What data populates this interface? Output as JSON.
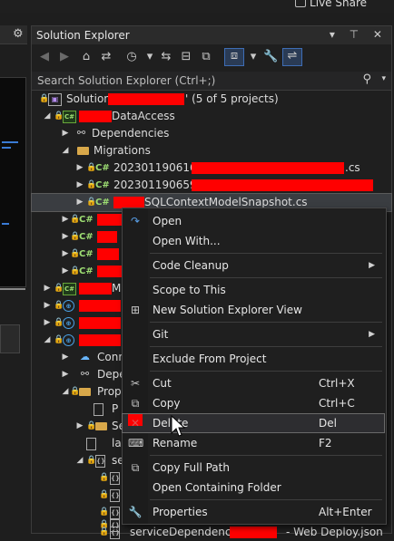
{
  "top": {
    "live_share": "Live Share"
  },
  "explorer": {
    "title": "Solution Explorer",
    "title_buttons": "▾ ⊤ ✕",
    "search_placeholder": "Search Solution Explorer (Ctrl+;)",
    "tree": [
      {
        "icon": "sol",
        "icon_text": "▣",
        "label": "Solution '",
        "suffix": "' (5 of 5 projects)"
      },
      {
        "icon": "proj",
        "icon_text": "C#",
        "label": "DataAccess"
      },
      {
        "icon": "dep",
        "icon_text": "⚯",
        "label": "Dependencies"
      },
      {
        "icon": "folder",
        "icon_text": "",
        "label": "Migrations"
      },
      {
        "icon": "cs",
        "icon_text": "C#",
        "label": "20230119061616_",
        "suffix": ".cs"
      },
      {
        "icon": "cs",
        "icon_text": "C#",
        "label": "20230119065917_"
      },
      {
        "icon": "cs",
        "icon_text": "C#",
        "label": "SQLContextModelSnapshot.cs"
      },
      {
        "icon": "cs",
        "icon_text": "C#",
        "label": ""
      },
      {
        "icon": "cs",
        "icon_text": "C#",
        "label": ""
      },
      {
        "icon": "cs",
        "icon_text": "C#",
        "label": ""
      },
      {
        "icon": "cs",
        "icon_text": "C#",
        "label": ""
      },
      {
        "icon": "proj",
        "icon_text": "C#",
        "label": "M"
      },
      {
        "icon": "web",
        "icon_text": "⊕",
        "label": ""
      },
      {
        "icon": "web",
        "icon_text": "⊕",
        "label": ""
      },
      {
        "icon": "web",
        "icon_text": "⊕",
        "label": ""
      },
      {
        "icon": "cloud",
        "icon_text": "☁",
        "label": "Conn"
      },
      {
        "icon": "dep",
        "icon_text": "⚯",
        "label": "Depe"
      },
      {
        "icon": "folder",
        "icon_text": "",
        "label": "Prop"
      },
      {
        "icon": "doc",
        "icon_text": "",
        "label": "P"
      },
      {
        "icon": "folder",
        "icon_text": "",
        "label": "Se"
      },
      {
        "icon": "doc",
        "icon_text": "",
        "label": "la"
      },
      {
        "icon": "doc",
        "icon_text": "{}",
        "label": "se"
      },
      {
        "icon": "doc",
        "icon_text": "{}",
        "label": ""
      },
      {
        "icon": "doc",
        "icon_text": "{}",
        "label": ""
      },
      {
        "icon": "doc",
        "icon_text": "{}",
        "label": ""
      },
      {
        "icon": "doc",
        "icon_text": "{}",
        "label": ""
      },
      {
        "icon": "doc",
        "icon_text": "{}",
        "label": "serviceDependencies",
        "suffix": "- Web Deploy.json"
      }
    ]
  },
  "menu": {
    "open": "Open",
    "open_with": "Open With...",
    "code_cleanup": "Code Cleanup",
    "scope_to_this": "Scope to This",
    "new_view": "New Solution Explorer View",
    "git": "Git",
    "exclude": "Exclude From Project",
    "cut": "Cut",
    "cut_key": "Ctrl+X",
    "copy": "Copy",
    "copy_key": "Ctrl+C",
    "delete": "Delete",
    "delete_key": "Del",
    "rename": "Rename",
    "rename_key": "F2",
    "copy_full_path": "Copy Full Path",
    "open_containing": "Open Containing Folder",
    "properties": "Properties",
    "properties_key": "Alt+Enter"
  }
}
